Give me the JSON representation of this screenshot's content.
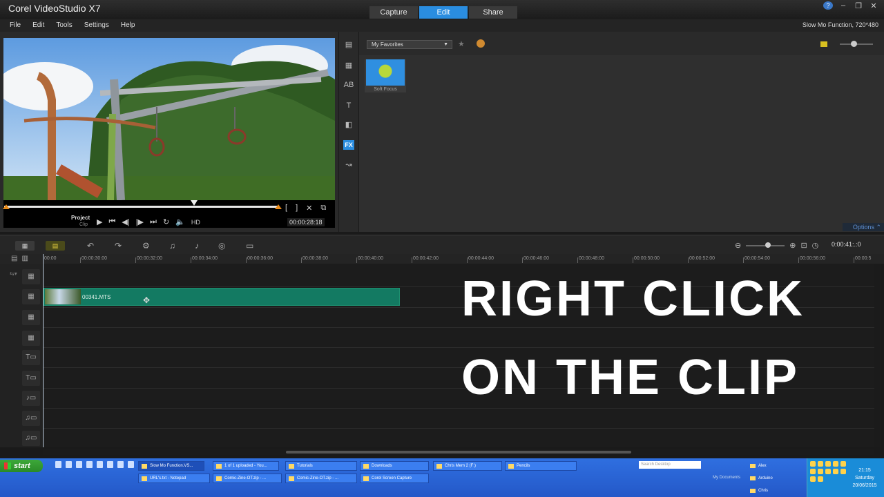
{
  "app": {
    "title": "Corel VideoStudio X7",
    "project_info": "Slow Mo Function, 720*480"
  },
  "mode_tabs": [
    {
      "label": "Capture",
      "active": false
    },
    {
      "label": "Edit",
      "active": true
    },
    {
      "label": "Share",
      "active": false
    }
  ],
  "menu": [
    "File",
    "Edit",
    "Tools",
    "Settings",
    "Help"
  ],
  "preview": {
    "project_label": "Project",
    "clip_label": "Clip",
    "hd_label": "HD",
    "timecode": "00:00:28:18",
    "playback_position": 0.69
  },
  "library": {
    "dropdown_value": "My Favorites",
    "items": [
      {
        "label": "Soft Focus"
      }
    ],
    "options_label": "Options"
  },
  "timeline": {
    "timecode": "0:00:41:.:0",
    "ruler": [
      "00:00",
      "00:00:30:00",
      "00:00:32:00",
      "00:00:34:00",
      "00:00:36:00",
      "00:00:38:00",
      "00:00:40:00",
      "00:00:42:00",
      "00:00:44:00",
      "00:00:46:00",
      "00:00:48:00",
      "00:00:50:00",
      "00:00:52:00",
      "00:00:54:00",
      "00:00:56:00",
      "00:00:5"
    ],
    "clip": {
      "name": "00341.MTS"
    }
  },
  "overlay": {
    "line1": "RIGHT CLICK",
    "line2": "ON THE CLIP"
  },
  "taskbar": {
    "start": "start",
    "tasks_top": [
      "Slow Mo Function.VS...",
      "1 of 1 uploaded - You...",
      "Tutorials",
      "Downloads",
      "Chris Mem 2 (F:)",
      "Pencils"
    ],
    "tasks_bottom": [
      "URL's.txt - Notepad",
      "Comic-Zine-OT.zip - ...",
      "Comic-Zine-OT.zip - ...",
      "Corel Screen Capture"
    ],
    "search_placeholder": "Search Desktop",
    "my_documents": "My Documents",
    "folders": [
      "Alex",
      "Arduino",
      "Chris"
    ],
    "clock_time": "21:15",
    "clock_day": "Saturday",
    "clock_date": "20/06/2015"
  },
  "colors": {
    "accent": "#2a8de0",
    "clip": "#137a62",
    "taskbar": "#2458c8"
  }
}
